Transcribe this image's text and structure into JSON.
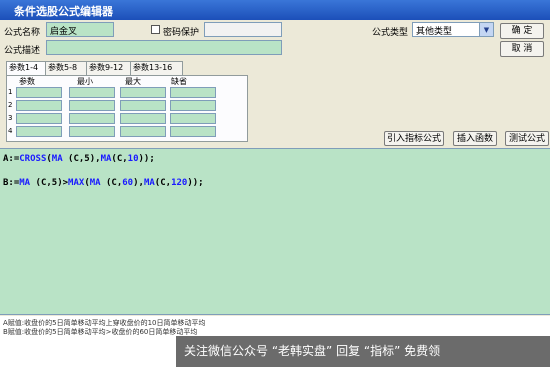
{
  "window": {
    "title": "条件选股公式编辑器"
  },
  "form": {
    "name_label": "公式名称",
    "name_value": "启金叉",
    "password_label": "密码保护",
    "desc_label": "公式描述",
    "type_label": "公式类型",
    "type_value": "其他类型",
    "ok_button": "确  定",
    "cancel_button": "取  消"
  },
  "params": {
    "tabs": [
      "参数1-4",
      "参数5-8",
      "参数9-12",
      "参数13-16"
    ],
    "columns": [
      "参数",
      "最小",
      "最大",
      "缺省"
    ],
    "rows": [
      "1",
      "2",
      "3",
      "4"
    ]
  },
  "buttons": {
    "import_indicator": "引入指标公式",
    "insert_function": "插入函数",
    "test_formula": "测试公式"
  },
  "code": {
    "line1": [
      {
        "t": "A:=",
        "c": "c-id"
      },
      {
        "t": "CROSS",
        "c": "c-fn"
      },
      {
        "t": "(",
        "c": "c-op"
      },
      {
        "t": "MA",
        "c": "c-fn"
      },
      {
        "t": " (C,5),",
        "c": "c-op"
      },
      {
        "t": "MA",
        "c": "c-fn"
      },
      {
        "t": "(C,",
        "c": "c-op"
      },
      {
        "t": "10",
        "c": "c-num"
      },
      {
        "t": "));",
        "c": "c-op"
      }
    ],
    "line2": [
      {
        "t": "B:=",
        "c": "c-id"
      },
      {
        "t": "MA",
        "c": "c-fn"
      },
      {
        "t": " (C,5)>",
        "c": "c-op"
      },
      {
        "t": "MAX",
        "c": "c-fn"
      },
      {
        "t": "(",
        "c": "c-op"
      },
      {
        "t": "MA",
        "c": "c-fn"
      },
      {
        "t": " (C,",
        "c": "c-op"
      },
      {
        "t": "60",
        "c": "c-num"
      },
      {
        "t": "),",
        "c": "c-op"
      },
      {
        "t": "MA",
        "c": "c-fn"
      },
      {
        "t": "(C,",
        "c": "c-op"
      },
      {
        "t": "120",
        "c": "c-num"
      },
      {
        "t": "));",
        "c": "c-op"
      }
    ]
  },
  "help": {
    "line1": "A赋值:收盘价的5日简单移动平均上穿收盘价的10日简单移动平均",
    "line2": "B赋值:收盘价的5日简单移动平均>收盘价的60日简单移动平均"
  },
  "watermark": "关注微信公众号 “老韩实盘” 回复 “指标” 免费领"
}
